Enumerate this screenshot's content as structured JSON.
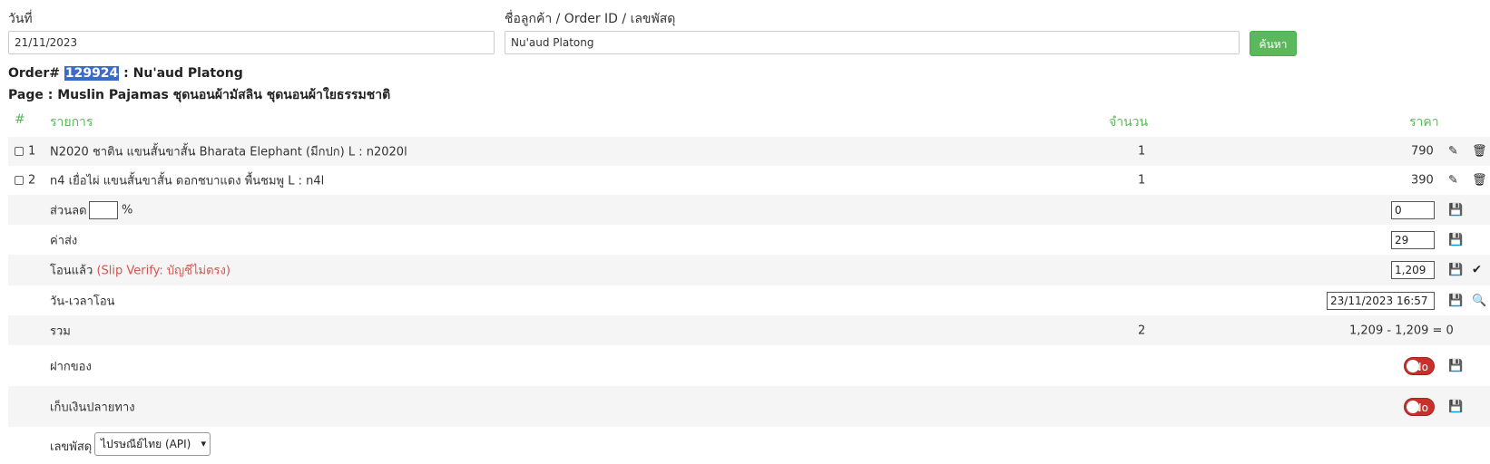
{
  "search": {
    "date_label": "วันที่",
    "date_value": "21/11/2023",
    "query_label": "ชื่อลูกค้า / Order ID / เลขพัสดุ",
    "query_value": "Nu'aud Platong",
    "search_button": "ค้นหา"
  },
  "order": {
    "prefix": "Order#",
    "id": "129924",
    "customer": ": Nu'aud Platong",
    "page_line": "Page : Muslin Pajamas ชุดนอนผ้ามัสลิน ชุดนอนผ้าใยธรรมชาติ"
  },
  "table": {
    "headers": {
      "num": "#",
      "item": "รายการ",
      "qty": "จำนวน",
      "price": "ราคา"
    },
    "items": [
      {
        "num": "1",
        "name": "N2020 ชาติน แขนสั้นขาสั้น Bharata Elephant (มีกปก) L : n2020l",
        "qty": "1",
        "price": "790"
      },
      {
        "num": "2",
        "name": "n4 เยื่อไผ่ แขนสั้นขาสั้น ดอกชบาแดง พื้นชมพู L : n4l",
        "qty": "1",
        "price": "390"
      }
    ],
    "discount": {
      "label": "ส่วนลด",
      "percent_sign": "%",
      "percent_value": "",
      "value": "0"
    },
    "shipping": {
      "label": "ค่าส่ง",
      "value": "29"
    },
    "paid": {
      "label": "โอนแล้ว",
      "note": "(Slip Verify: บัญชีไม่ตรง)",
      "value": "1,209"
    },
    "transfer_time": {
      "label": "วัน-เวลาโอน",
      "value": "23/11/2023 16:57"
    },
    "total": {
      "label": "รวม",
      "qty": "2",
      "summary": "1,209 - 1,209 = 0"
    },
    "deposit": {
      "label": "ฝากของ",
      "toggle": "No"
    },
    "cod": {
      "label": "เก็บเงินปลายทาง",
      "toggle": "No"
    },
    "tracking": {
      "label": "เลขพัสดุ",
      "carrier": "ไปรษณีย์ไทย (API)"
    }
  },
  "colors": {
    "accent": "#5cb85c",
    "danger": "#c9302c",
    "highlight": "#3b6bc9"
  }
}
